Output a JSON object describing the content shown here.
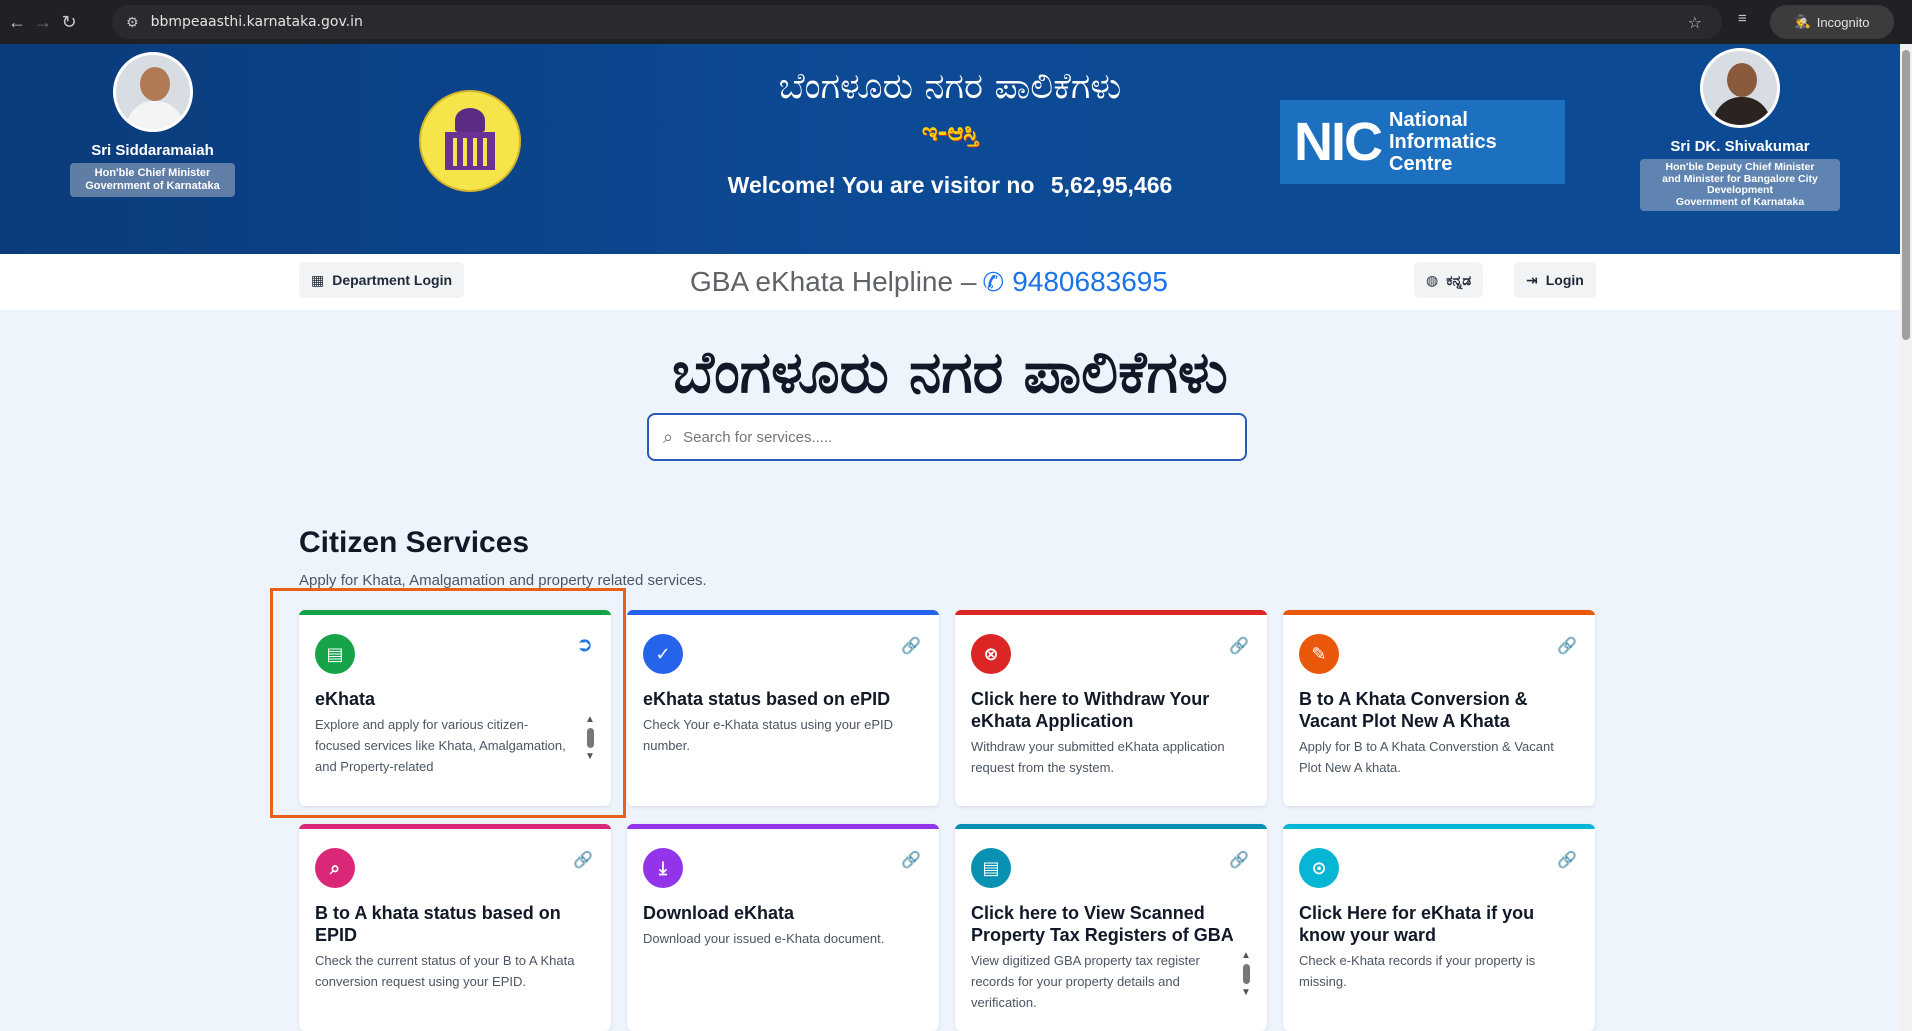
{
  "browser": {
    "url": "bbmpeaasthi.karnataka.gov.in",
    "profile": "Incognito"
  },
  "header": {
    "left_person": {
      "name": "Sri Siddaramaiah",
      "title_line1": "Hon'ble Chief Minister",
      "title_line2": "Government of Karnataka"
    },
    "right_person": {
      "name": "Sri DK. Shivakumar",
      "title_line1": "Hon'ble Deputy Chief Minister",
      "title_line2": "and Minister for Bangalore City",
      "title_line3": "Development",
      "title_line4": "Government of Karnataka"
    },
    "title_kannada": "ಬೆಂಗಳೂರು ನಗರ ಪಾಲಿಕೆಗಳು",
    "subtitle_kannada": "ಇ-ಆಸ್ತಿ",
    "visitor_label": "Welcome! You are visitor no",
    "visitor_count": "5,62,95,466",
    "nic_letters": "NIC",
    "nic_line1": "National",
    "nic_line2": "Informatics",
    "nic_line3": "Centre"
  },
  "topbar": {
    "department_login": "Department Login",
    "helpline_label": "GBA eKhata Helpline –",
    "helpline_number": "9480683695",
    "language": "ಕನ್ನಡ",
    "login": "Login"
  },
  "hero": {
    "title": "ಬೆಂಗಳೂರು ನಗರ ಪಾಲಿಕೆಗಳು",
    "search_placeholder": "Search for services....."
  },
  "citizen_services": {
    "title": "Citizen Services",
    "subtitle": "Apply for Khata, Amalgamation and property related services.",
    "cards": [
      {
        "title": "eKhata",
        "desc": "Explore and apply for various citizen-focused services like Khata, Amalgamation, and Property-related",
        "color": "#16a34a",
        "icon": "file-icon"
      },
      {
        "title": "eKhata status based on ePID",
        "desc": "Check Your e-Khata status using your ePID number.",
        "color": "#2563eb",
        "icon": "check-icon"
      },
      {
        "title": "Click here to Withdraw Your eKhata Application",
        "desc": "Withdraw your submitted eKhata application request from the system.",
        "color": "#dc2626",
        "icon": "cancel-icon"
      },
      {
        "title": "B to A Khata Conversion & Vacant Plot New A Khata",
        "desc": "Apply for B to A Khata Converstion & Vacant Plot New A khata.",
        "color": "#ea580c",
        "icon": "edit-icon"
      },
      {
        "title": "B to A khata status based on EPID",
        "desc": "Check the current status of your B to A Khata conversion request using your EPID.",
        "color": "#db2777",
        "icon": "search-icon"
      },
      {
        "title": "Download eKhata",
        "desc": "Download your issued e-Khata document.",
        "color": "#9333ea",
        "icon": "download-icon"
      },
      {
        "title": "Click here to View Scanned Property Tax Registers of GBA",
        "desc": "View digitized GBA property tax register records for your property details and verification.",
        "color": "#0891b2",
        "icon": "document-icon"
      },
      {
        "title": "Click Here for eKhata if you know your ward",
        "desc": "Check e-Khata records if your property is missing.",
        "color": "#06b6d4",
        "icon": "location-icon"
      }
    ]
  }
}
